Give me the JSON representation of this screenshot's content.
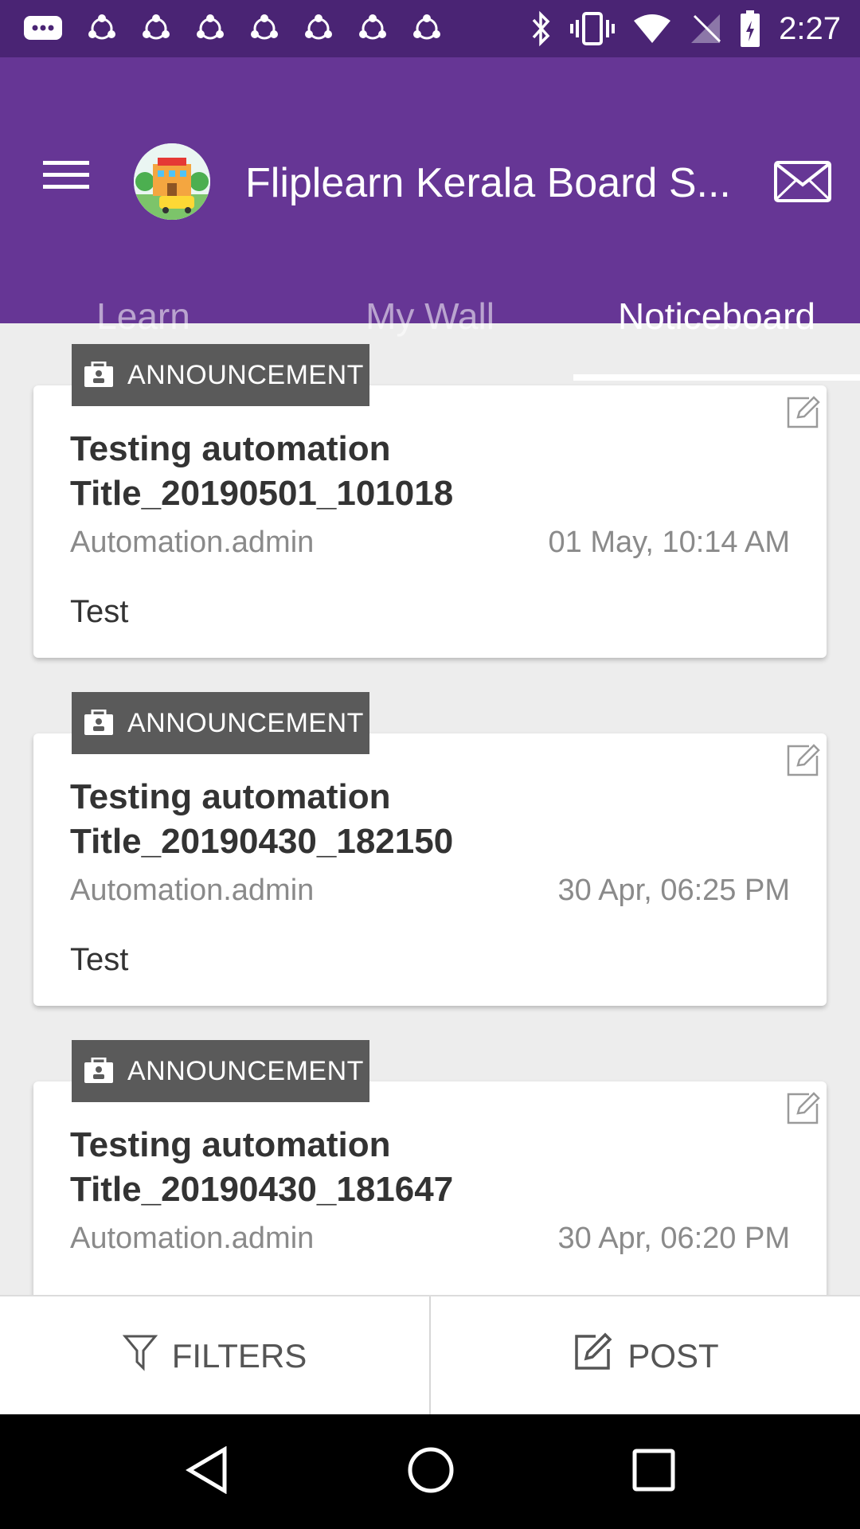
{
  "status_bar": {
    "time": "2:27",
    "left_icons": [
      "messages-icon",
      "sync-icon",
      "sync-icon",
      "sync-icon",
      "sync-icon",
      "sync-icon",
      "sync-icon",
      "sync-icon"
    ],
    "right_icons": [
      "bluetooth-icon",
      "vibrate-icon",
      "wifi-icon",
      "no-signal-icon",
      "battery-icon"
    ]
  },
  "app_bar": {
    "title": "Fliplearn Kerala Board S...",
    "tabs": [
      {
        "label": "Learn",
        "active": false
      },
      {
        "label": "My Wall",
        "active": false
      },
      {
        "label": "Noticeboard",
        "active": true
      }
    ]
  },
  "posts": [
    {
      "badge": "ANNOUNCEMENT",
      "title": "Testing automation Title_20190501_101018",
      "author": "Automation.admin",
      "time": "01 May, 10:14 AM",
      "body": "Test"
    },
    {
      "badge": "ANNOUNCEMENT",
      "title": "Testing automation Title_20190430_182150",
      "author": "Automation.admin",
      "time": "30 Apr, 06:25 PM",
      "body": "Test"
    },
    {
      "badge": "ANNOUNCEMENT",
      "title": "Testing automation Title_20190430_181647",
      "author": "Automation.admin",
      "time": "30 Apr, 06:20 PM",
      "body": ""
    }
  ],
  "actions": {
    "filters_label": "FILTERS",
    "post_label": "POST"
  },
  "colors": {
    "status_bar": "#4a2474",
    "app_bar": "#663695",
    "badge": "#5a5a5a"
  }
}
